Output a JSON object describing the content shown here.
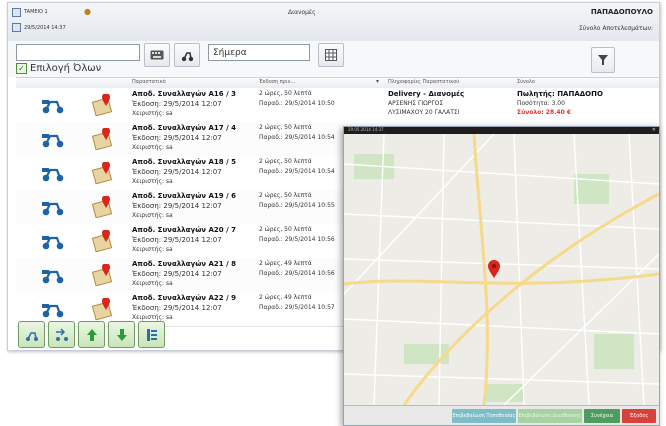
{
  "colors": {
    "accent_red": "#d8261b",
    "total_red": "#e0322a",
    "map_water_green": "#c8e6c0",
    "confirm_btn": "#7dbdc7",
    "disabled_btn": "#a7d3a3",
    "next_btn": "#4f9c5f",
    "exit_btn": "#d9413b"
  },
  "header": {
    "user": "TAMEIO 1",
    "datetime": "29/5/2014 14:37",
    "module": "Διανομές",
    "salesperson": "ΠΑΠΑΔΟΠΟΥΛΟ",
    "results_label": "Σύνολο Αποτελεσμάτων:"
  },
  "toolbar": {
    "search_value": "",
    "date_value": "Σήμερα",
    "select_all_label": "Επιλογή Όλων",
    "icons": {
      "barcode": "keyboard-icon",
      "fork": "scooter-icon",
      "calendar": "calendar-icon",
      "filter": "filter-icon"
    }
  },
  "table": {
    "columns": [
      "Παραστατικό",
      "Έκδοση πριν...",
      "Πληροφορίες Παραστατικού",
      "Σύνολο"
    ],
    "rows": [
      {
        "doc": "Αποδ. Συναλλαγών A16 / 3",
        "issued": "Έκδοση: 29/5/2014 12:07",
        "cashier": "Χειριστής: sa",
        "ago": "2 ώρες, 50 λεπτά",
        "delivery": "Παραδ.: 29/5/2014 10:50",
        "info1": "Delivery - Διανομές",
        "info2": "ΑΡΣΕΝΗΣ ΓΙΩΡΓΟΣ",
        "info3": "ΛΥΣΙΜΑΧΟΥ 20 ΓΑΛΑΤΣΙ",
        "total1": "Πωλητής: ΠΑΠΑΔΟΠΟ",
        "total2": "Ποσότητα: 3.00",
        "total3": "Σύνολο: 28.40 €"
      },
      {
        "doc": "Αποδ. Συναλλαγών A17 / 4",
        "issued": "Έκδοση: 29/5/2014 12:07",
        "cashier": "Χειριστής: sa",
        "ago": "2 ώρες, 50 λεπτά",
        "delivery": "Παραδ.: 29/5/2014 10:54"
      },
      {
        "doc": "Αποδ. Συναλλαγών A18 / 5",
        "issued": "Έκδοση: 29/5/2014 12:07",
        "cashier": "Χειριστής: sa",
        "ago": "2 ώρες, 50 λεπτά",
        "delivery": "Παραδ.: 29/5/2014 10:54"
      },
      {
        "doc": "Αποδ. Συναλλαγών A19 / 6",
        "issued": "Έκδοση: 29/5/2014 12:07",
        "cashier": "Χειριστής: sa",
        "ago": "2 ώρες, 50 λεπτά",
        "delivery": "Παραδ.: 29/5/2014 10:55"
      },
      {
        "doc": "Αποδ. Συναλλαγών A20 / 7",
        "issued": "Έκδοση: 29/5/2014 12:07",
        "cashier": "Χειριστής: sa",
        "ago": "2 ώρες, 50 λεπτά",
        "delivery": "Παραδ.: 29/5/2014 10:56"
      },
      {
        "doc": "Αποδ. Συναλλαγών A21 / 8",
        "issued": "Έκδοση: 29/5/2014 12:07",
        "cashier": "Χειριστής: sa",
        "ago": "2 ώρες, 49 λεπτά",
        "delivery": "Παραδ.: 29/5/2014 10:56"
      },
      {
        "doc": "Αποδ. Συναλλαγών A22 / 9",
        "issued": "Έκδοση: 29/5/2014 12:07",
        "cashier": "Χειριστής: sa",
        "ago": "2 ώρες, 49 λεπτά",
        "delivery": "Παραδ.: 29/5/2014 10:57"
      }
    ]
  },
  "bottom_icons": [
    "scooter-out-icon",
    "scooter-return-icon",
    "arrow-up-icon",
    "arrow-down-icon",
    "list-icon"
  ],
  "map": {
    "title": "29.05.2014 14:37",
    "buttons": {
      "confirm": "Επιβεβαίωση Τοποθεσίας",
      "disabled": "Επιβεβαίωση Διεύθυνσης",
      "next": "Συνέχεια",
      "exit": "Έξοδος"
    }
  }
}
